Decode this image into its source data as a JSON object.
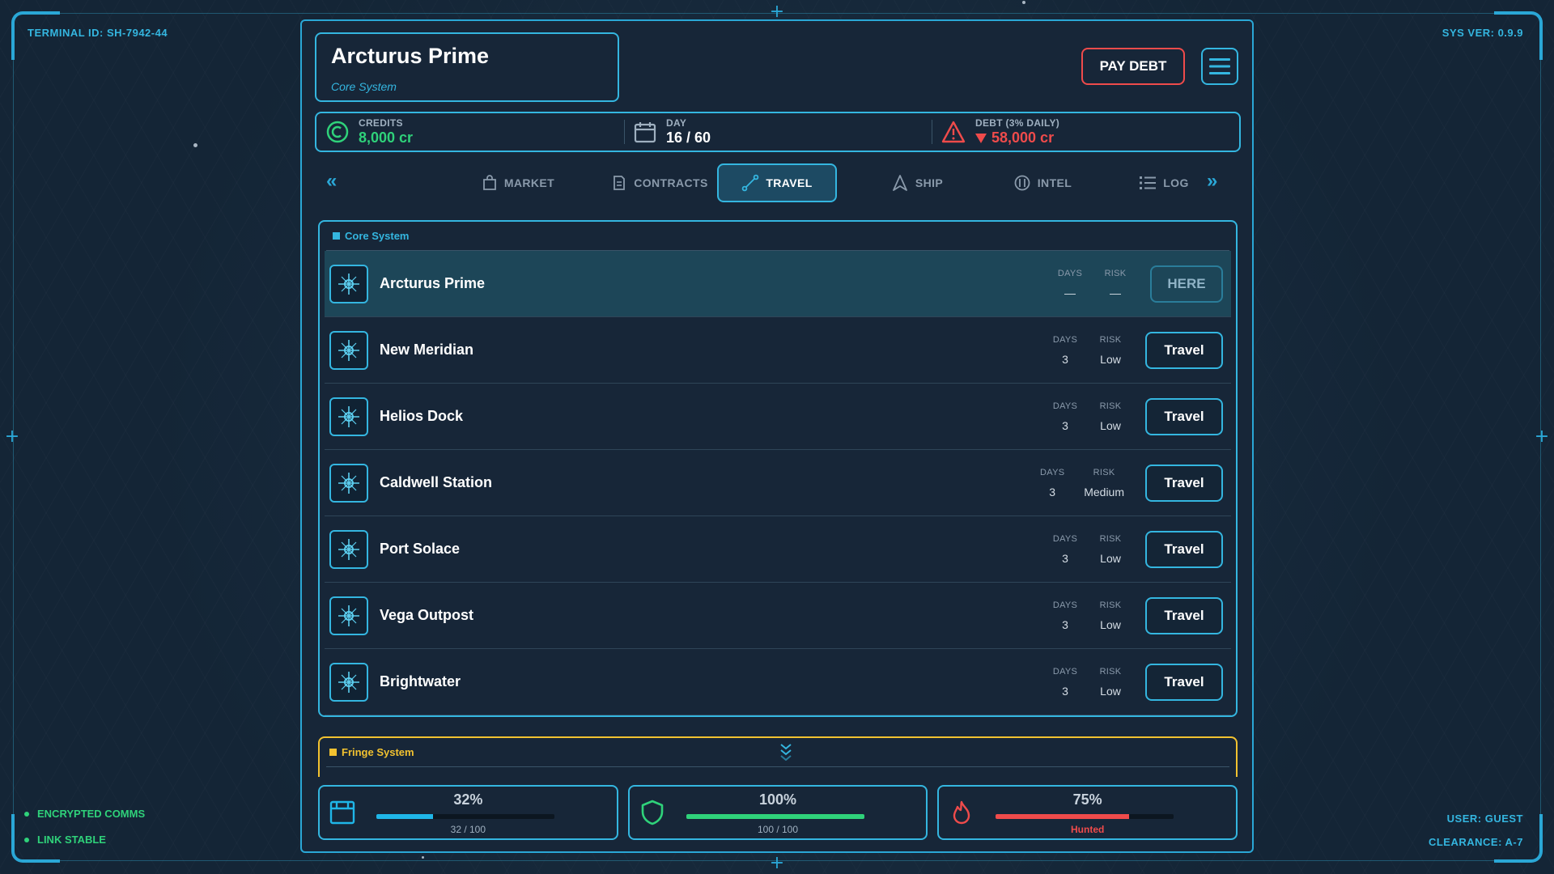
{
  "hud": {
    "terminal_id": "TERMINAL ID: SH-7942-44",
    "sys_ver": "SYS VER: 0.9.9",
    "status": [
      "ENCRYPTED COMMS",
      "LINK STABLE"
    ],
    "user": "USER: GUEST",
    "clearance": "CLEARANCE: A-7"
  },
  "location": {
    "name": "Arcturus Prime",
    "system": "Core System"
  },
  "actions": {
    "pay_debt": "PAY DEBT",
    "menu_icon": "hamburger-menu-icon"
  },
  "stats": {
    "credits": {
      "label": "CREDITS",
      "value": "8,000 cr",
      "color": "#2fd27a",
      "icon": "credits-icon"
    },
    "day": {
      "label": "DAY",
      "value": "16 / 60",
      "color": "#ffffff",
      "icon": "calendar-icon"
    },
    "debt": {
      "label": "DEBT (3% DAILY)",
      "value": "58,000 cr",
      "color": "#ef4b4b",
      "icon": "warning-icon",
      "trend": "down"
    }
  },
  "tabs": [
    {
      "label": "MARKET",
      "icon": "bag-icon"
    },
    {
      "label": "CONTRACTS",
      "icon": "document-icon"
    },
    {
      "label": "TRAVEL",
      "icon": "route-icon",
      "active": true
    },
    {
      "label": "SHIP",
      "icon": "ship-icon"
    },
    {
      "label": "INTEL",
      "icon": "intel-icon"
    },
    {
      "label": "LOG",
      "icon": "list-icon"
    }
  ],
  "core_section": {
    "title": "Core System",
    "days_label": "DAYS",
    "risk_label": "RISK",
    "destinations": [
      {
        "name": "Arcturus Prime",
        "days": "—",
        "risk": "—",
        "action": "HERE",
        "current": true
      },
      {
        "name": "New Meridian",
        "days": "3",
        "risk": "Low",
        "action": "Travel"
      },
      {
        "name": "Helios Dock",
        "days": "3",
        "risk": "Low",
        "action": "Travel"
      },
      {
        "name": "Caldwell Station",
        "days": "3",
        "risk": "Medium",
        "action": "Travel"
      },
      {
        "name": "Port Solace",
        "days": "3",
        "risk": "Low",
        "action": "Travel"
      },
      {
        "name": "Vega Outpost",
        "days": "3",
        "risk": "Low",
        "action": "Travel"
      },
      {
        "name": "Brightwater",
        "days": "3",
        "risk": "Low",
        "action": "Travel"
      }
    ]
  },
  "fringe_section": {
    "title": "Fringe System",
    "collapsed": true
  },
  "gauges": [
    {
      "name": "cargo",
      "icon": "cargo-icon",
      "percent": "32%",
      "fraction": 0.32,
      "sub": "32 / 100",
      "color": "#1fb6e8",
      "sub_color": "#9fb0c0"
    },
    {
      "name": "hull",
      "icon": "shield-icon",
      "percent": "100%",
      "fraction": 1.0,
      "sub": "100 / 100",
      "color": "#2fd27a",
      "sub_color": "#9fb0c0"
    },
    {
      "name": "heat",
      "icon": "flame-icon",
      "percent": "75%",
      "fraction": 0.75,
      "sub": "Hunted",
      "color": "#ef4b4b",
      "sub_color": "#ef4b4b"
    }
  ]
}
